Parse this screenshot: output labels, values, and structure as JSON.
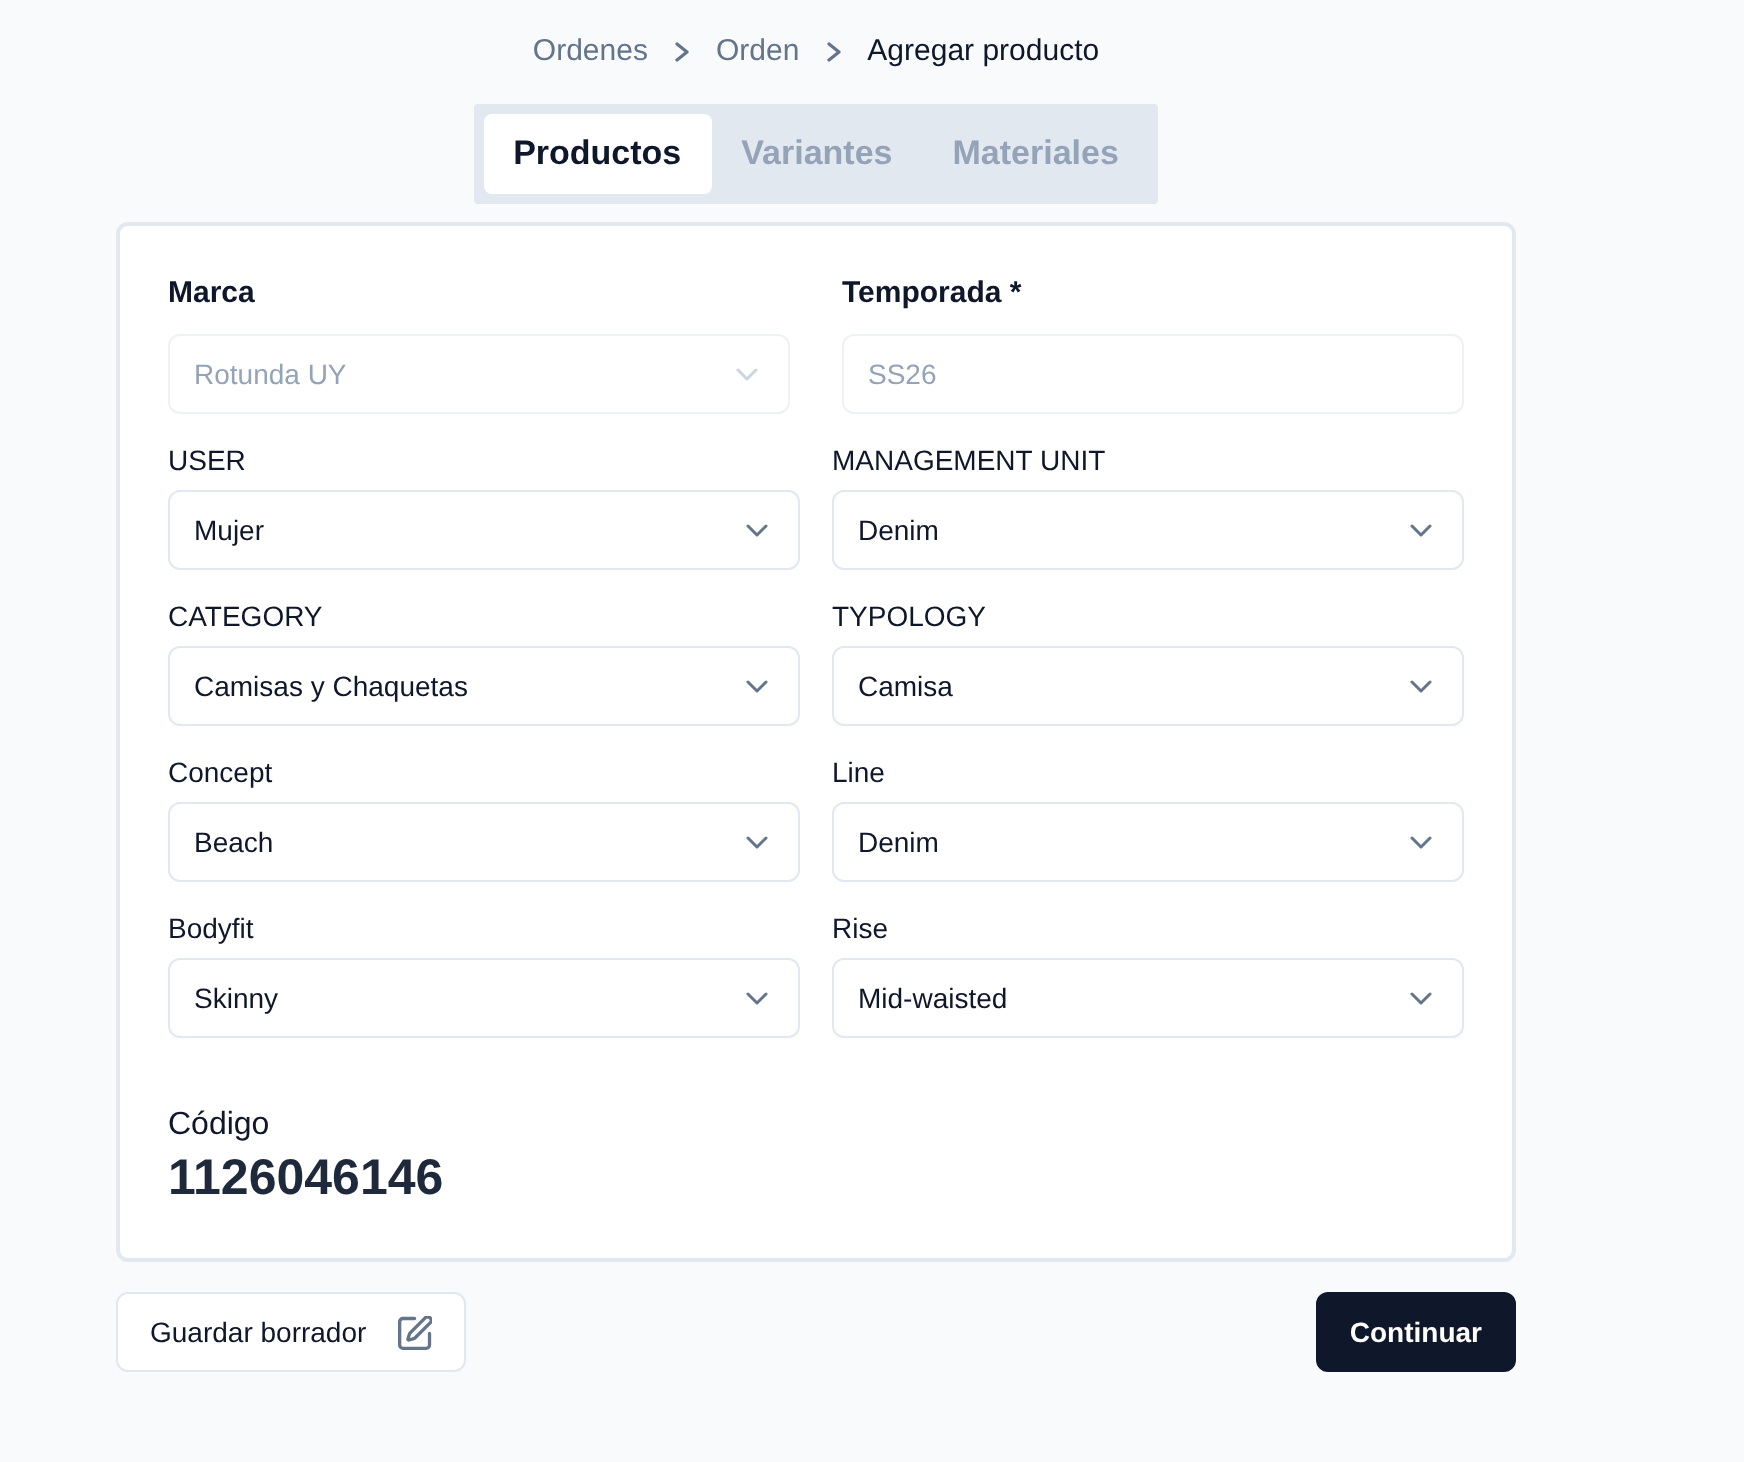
{
  "breadcrumb": [
    {
      "label": "Ordenes",
      "current": false
    },
    {
      "label": "Orden",
      "current": false
    },
    {
      "label": "Agregar producto",
      "current": true
    }
  ],
  "tabs": [
    {
      "label": "Productos",
      "selected": true
    },
    {
      "label": "Variantes",
      "selected": false
    },
    {
      "label": "Materiales",
      "selected": false
    }
  ],
  "header_fields": [
    {
      "label": "Marca",
      "kind": "select",
      "value": "Rotunda UY",
      "disabled": true
    },
    {
      "label": "Temporada *",
      "kind": "text",
      "value": "SS26",
      "disabled": true
    }
  ],
  "fields": [
    {
      "label": "USER",
      "kind": "select",
      "value": "Mujer",
      "disabled": false
    },
    {
      "label": "MANAGEMENT UNIT",
      "kind": "select",
      "value": "Denim",
      "disabled": false
    },
    {
      "label": "CATEGORY",
      "kind": "select",
      "value": "Camisas y Chaquetas",
      "disabled": false
    },
    {
      "label": "TYPOLOGY",
      "kind": "select",
      "value": "Camisa",
      "disabled": false
    },
    {
      "label": "Concept",
      "kind": "select",
      "value": "Beach",
      "disabled": false
    },
    {
      "label": "Line",
      "kind": "select",
      "value": "Denim",
      "disabled": false
    },
    {
      "label": "Bodyfit",
      "kind": "select",
      "value": "Skinny",
      "disabled": false
    },
    {
      "label": "Rise",
      "kind": "select",
      "value": "Mid-waisted",
      "disabled": false
    }
  ],
  "code": {
    "label": "Código",
    "value": "1126046146"
  },
  "actions": [
    {
      "label": "Guardar borrador",
      "kind": "secondary"
    },
    {
      "label": "Continuar",
      "kind": "primary"
    }
  ]
}
